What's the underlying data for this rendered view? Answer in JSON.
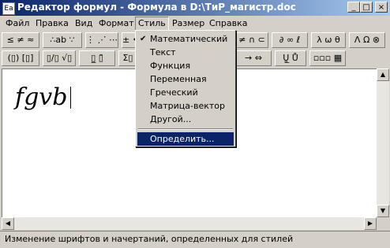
{
  "window": {
    "title": "Редактор формул - Формула в D:\\ТиР_магистр.doc",
    "icon_label": "Ea",
    "minimize": "_",
    "maximize": "□",
    "close": "×"
  },
  "menubar": {
    "items": [
      "Файл",
      "Правка",
      "Вид",
      "Формат",
      "Стиль",
      "Размер",
      "Справка"
    ]
  },
  "toolbar_row1": [
    "≤ ≠ ≈",
    "∴ab ∵",
    "⋮ ⋰ ⋯",
    "± •",
    "≠ ∩ ⊂",
    "∂ ∞ ℓ",
    "λ ω θ",
    "Λ Ω ⊗"
  ],
  "toolbar_row2": [
    "(▯) [▯]",
    "▯/▯ √▯",
    "▯̲ ▯̄",
    "Σ▯",
    "→ ⇔",
    "Ṵ̲ Ů",
    "▫▫▫ ▦"
  ],
  "style_menu": {
    "items": [
      "Математический",
      "Текст",
      "Функция",
      "Переменная",
      "Греческий",
      "Матрица-вектор",
      "Другой..."
    ],
    "checked_index": 0,
    "define": "Определить..."
  },
  "editor": {
    "formula": "fgvb"
  },
  "scroll": {
    "up": "▲",
    "down": "▼",
    "left": "◀",
    "right": "▶"
  },
  "status": {
    "text": "Изменение шрифтов и начертаний, определенных для стилей"
  }
}
